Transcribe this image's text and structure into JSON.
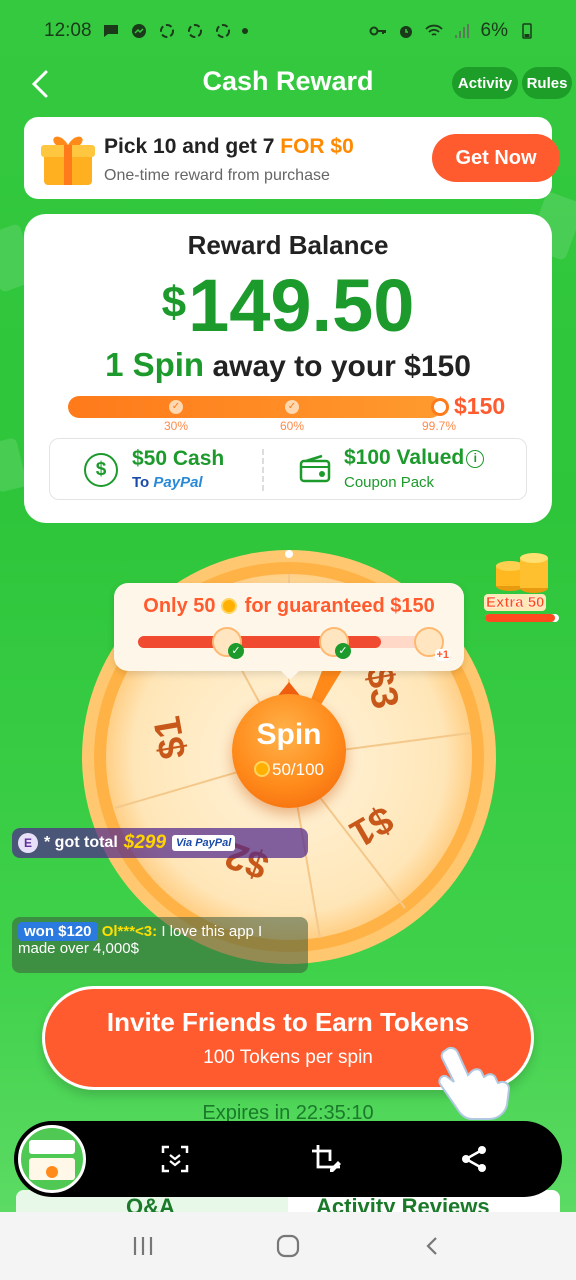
{
  "status_bar": {
    "time": "12:08",
    "battery": "6%"
  },
  "header": {
    "title": "Cash Reward",
    "activity_label": "Activity",
    "rules_label": "Rules"
  },
  "promo": {
    "title_main": "Pick 10 and get 7 ",
    "title_accent": "FOR $0",
    "subtitle": "One-time reward from purchase",
    "button": "Get Now"
  },
  "balance": {
    "title": "Reward Balance",
    "currency": "$",
    "amount": "149.50",
    "spin_count": "1 Spin",
    "spin_suffix": " away to your $150",
    "progress_percent": 99.7,
    "target": "$150",
    "milestones": [
      "30%",
      "60%",
      "99.7%"
    ],
    "reward1_title": "$50 Cash",
    "reward1_sub_prefix": "To ",
    "reward1_sub_brand": "PayPal",
    "reward2_title": "$100 Valued",
    "reward2_sub": "Coupon Pack"
  },
  "guarantee": {
    "text_a": "Only 50",
    "text_b": "for guaranteed $150",
    "progress_percent": 82,
    "plus_label": "+1"
  },
  "extra": {
    "label": "Extra 50",
    "progress_percent": 95
  },
  "wheel": {
    "labels": [
      "$3",
      "$1",
      "$1",
      "$2"
    ],
    "spin_label": "Spin",
    "spin_count": "50/100"
  },
  "ticker1": {
    "avatar": "E",
    "text": "* got total",
    "amount": "$299",
    "via": "Via PayPal"
  },
  "ticker2": {
    "won": "won $120",
    "user": "Ol***<3:",
    "message": "I love this app I made over 4,000$"
  },
  "invite": {
    "title": "Invite Friends to Earn Tokens",
    "subtitle": "100 Tokens per spin"
  },
  "expires": "Expires in 22:35:10",
  "bottom_tabs": {
    "left": "Q&A",
    "right": "Activity Reviews"
  },
  "colors": {
    "green": "#1c9a2c",
    "orange": "#ff5b2e",
    "background": "#2ec53b"
  }
}
